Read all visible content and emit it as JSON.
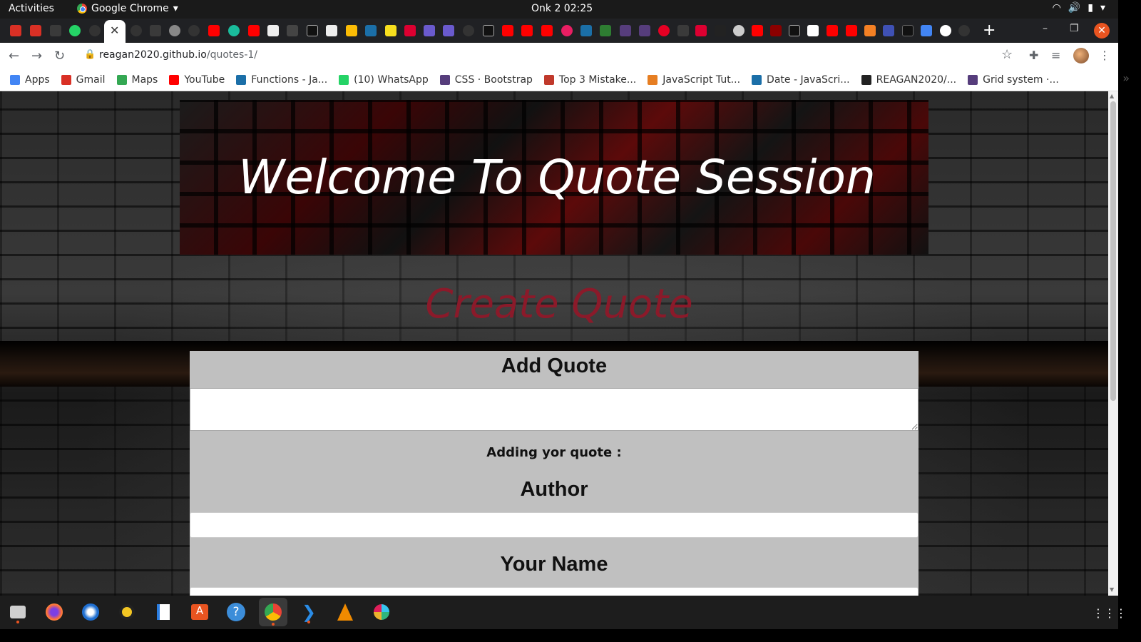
{
  "system": {
    "activities": "Activities",
    "app_name": "Google Chrome",
    "clock": "Onk 2  02:25"
  },
  "browser": {
    "url_host": "reagan2020.github.io",
    "url_path": "/quotes-1/",
    "bookmarks": [
      {
        "label": "Apps",
        "icon": "apps-grid-icon",
        "color": "#4285f4"
      },
      {
        "label": "Gmail",
        "icon": "gmail-icon",
        "color": "#d93025"
      },
      {
        "label": "Maps",
        "icon": "maps-icon",
        "color": "#34a853"
      },
      {
        "label": "YouTube",
        "icon": "youtube-icon",
        "color": "#ff0000"
      },
      {
        "label": "Functions - Ja...",
        "icon": "mdn-icon",
        "color": "#1b6fa8"
      },
      {
        "label": "(10) WhatsApp",
        "icon": "whatsapp-icon",
        "color": "#25d366"
      },
      {
        "label": "CSS · Bootstrap",
        "icon": "bootstrap-icon",
        "color": "#563d7c"
      },
      {
        "label": "Top 3 Mistake...",
        "icon": "w-icon",
        "color": "#c0392b"
      },
      {
        "label": "JavaScript Tut...",
        "icon": "spiral-icon",
        "color": "#e67e22"
      },
      {
        "label": "Date - JavaScri...",
        "icon": "mdn-icon",
        "color": "#1b6fa8"
      },
      {
        "label": "REAGAN2020/...",
        "icon": "github-icon",
        "color": "#222222"
      },
      {
        "label": "Grid system ·...",
        "icon": "bootstrap-icon",
        "color": "#563d7c"
      }
    ]
  },
  "page": {
    "hero_title": "Welcome To Quote Session",
    "create_title": "Create Quote",
    "form": {
      "add_quote_label": "Add Quote",
      "adding_text": "Adding yor quote :",
      "author_label": "Author",
      "your_name_label": "Your Name",
      "quote_value": "",
      "author_value": "",
      "name_value": ""
    }
  },
  "colors": {
    "create_title": "#8b1a2a",
    "form_bg": "#c0c0c0",
    "ubuntu_accent": "#e95420"
  }
}
